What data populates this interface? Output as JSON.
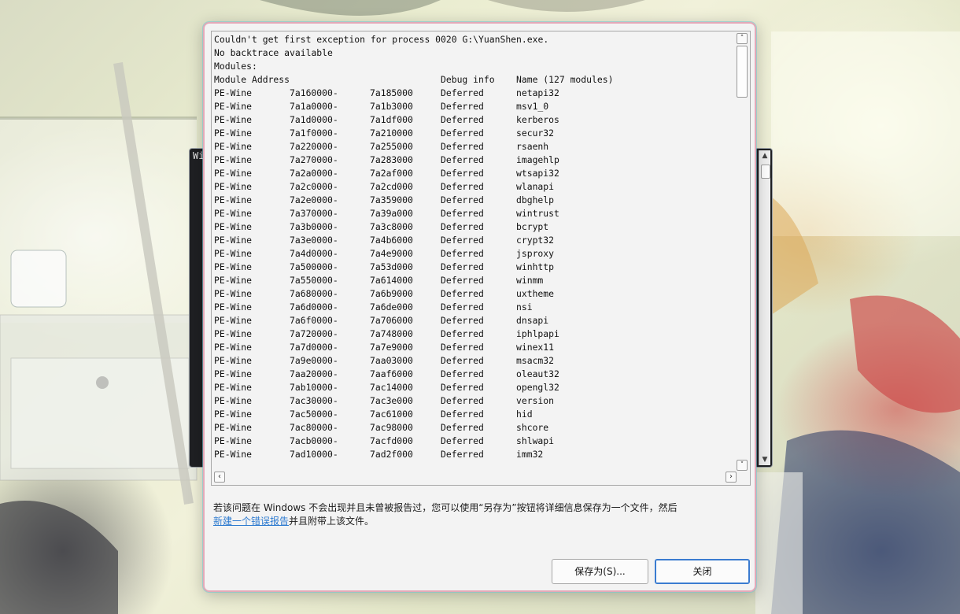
{
  "background_window": {
    "title_fragment": "Wi"
  },
  "dialog": {
    "log_header": [
      "Couldn't get first exception for process 0020 G:\\YuanShen.exe.",
      "No backtrace available",
      "Modules:"
    ],
    "columns": {
      "module": "Module",
      "address": "Address",
      "debug": "Debug info",
      "name": "Name (127 modules)"
    },
    "modules": [
      {
        "module": "PE-Wine",
        "start": "7a160000-",
        "end": "7a185000",
        "debug": "Deferred",
        "name": "netapi32"
      },
      {
        "module": "PE-Wine",
        "start": "7a1a0000-",
        "end": "7a1b3000",
        "debug": "Deferred",
        "name": "msv1_0"
      },
      {
        "module": "PE-Wine",
        "start": "7a1d0000-",
        "end": "7a1df000",
        "debug": "Deferred",
        "name": "kerberos"
      },
      {
        "module": "PE-Wine",
        "start": "7a1f0000-",
        "end": "7a210000",
        "debug": "Deferred",
        "name": "secur32"
      },
      {
        "module": "PE-Wine",
        "start": "7a220000-",
        "end": "7a255000",
        "debug": "Deferred",
        "name": "rsaenh"
      },
      {
        "module": "PE-Wine",
        "start": "7a270000-",
        "end": "7a283000",
        "debug": "Deferred",
        "name": "imagehlp"
      },
      {
        "module": "PE-Wine",
        "start": "7a2a0000-",
        "end": "7a2af000",
        "debug": "Deferred",
        "name": "wtsapi32"
      },
      {
        "module": "PE-Wine",
        "start": "7a2c0000-",
        "end": "7a2cd000",
        "debug": "Deferred",
        "name": "wlanapi"
      },
      {
        "module": "PE-Wine",
        "start": "7a2e0000-",
        "end": "7a359000",
        "debug": "Deferred",
        "name": "dbghelp"
      },
      {
        "module": "PE-Wine",
        "start": "7a370000-",
        "end": "7a39a000",
        "debug": "Deferred",
        "name": "wintrust"
      },
      {
        "module": "PE-Wine",
        "start": "7a3b0000-",
        "end": "7a3c8000",
        "debug": "Deferred",
        "name": "bcrypt"
      },
      {
        "module": "PE-Wine",
        "start": "7a3e0000-",
        "end": "7a4b6000",
        "debug": "Deferred",
        "name": "crypt32"
      },
      {
        "module": "PE-Wine",
        "start": "7a4d0000-",
        "end": "7a4e9000",
        "debug": "Deferred",
        "name": "jsproxy"
      },
      {
        "module": "PE-Wine",
        "start": "7a500000-",
        "end": "7a53d000",
        "debug": "Deferred",
        "name": "winhttp"
      },
      {
        "module": "PE-Wine",
        "start": "7a550000-",
        "end": "7a614000",
        "debug": "Deferred",
        "name": "winmm"
      },
      {
        "module": "PE-Wine",
        "start": "7a680000-",
        "end": "7a6b9000",
        "debug": "Deferred",
        "name": "uxtheme"
      },
      {
        "module": "PE-Wine",
        "start": "7a6d0000-",
        "end": "7a6de000",
        "debug": "Deferred",
        "name": "nsi"
      },
      {
        "module": "PE-Wine",
        "start": "7a6f0000-",
        "end": "7a706000",
        "debug": "Deferred",
        "name": "dnsapi"
      },
      {
        "module": "PE-Wine",
        "start": "7a720000-",
        "end": "7a748000",
        "debug": "Deferred",
        "name": "iphlpapi"
      },
      {
        "module": "PE-Wine",
        "start": "7a7d0000-",
        "end": "7a7e9000",
        "debug": "Deferred",
        "name": "winex11"
      },
      {
        "module": "PE-Wine",
        "start": "7a9e0000-",
        "end": "7aa03000",
        "debug": "Deferred",
        "name": "msacm32"
      },
      {
        "module": "PE-Wine",
        "start": "7aa20000-",
        "end": "7aaf6000",
        "debug": "Deferred",
        "name": "oleaut32"
      },
      {
        "module": "PE-Wine",
        "start": "7ab10000-",
        "end": "7ac14000",
        "debug": "Deferred",
        "name": "opengl32"
      },
      {
        "module": "PE-Wine",
        "start": "7ac30000-",
        "end": "7ac3e000",
        "debug": "Deferred",
        "name": "version"
      },
      {
        "module": "PE-Wine",
        "start": "7ac50000-",
        "end": "7ac61000",
        "debug": "Deferred",
        "name": "hid"
      },
      {
        "module": "PE-Wine",
        "start": "7ac80000-",
        "end": "7ac98000",
        "debug": "Deferred",
        "name": "shcore"
      },
      {
        "module": "PE-Wine",
        "start": "7acb0000-",
        "end": "7acfd000",
        "debug": "Deferred",
        "name": "shlwapi"
      },
      {
        "module": "PE-Wine",
        "start": "7ad10000-",
        "end": "7ad2f000",
        "debug": "Deferred",
        "name": "imm32"
      }
    ],
    "info_text_part1": "若该问题在 Windows 不会出现并且未曾被报告过，您可以使用“另存为”按钮将详细信息保存为一个文件，然后",
    "info_link": "新建一个错误报告",
    "info_text_part2": "并且附带上该文件。",
    "save_button": "保存为(S)...",
    "close_button": "关闭"
  },
  "icons": {
    "scroll_up": "chevron-up-icon",
    "scroll_down": "chevron-down-icon",
    "scroll_left": "chevron-left-icon",
    "scroll_right": "chevron-right-icon"
  },
  "colors": {
    "link": "#2e7bd0",
    "dialog_border": "#e4a9b8",
    "default_button_border": "#3a7bd0"
  }
}
